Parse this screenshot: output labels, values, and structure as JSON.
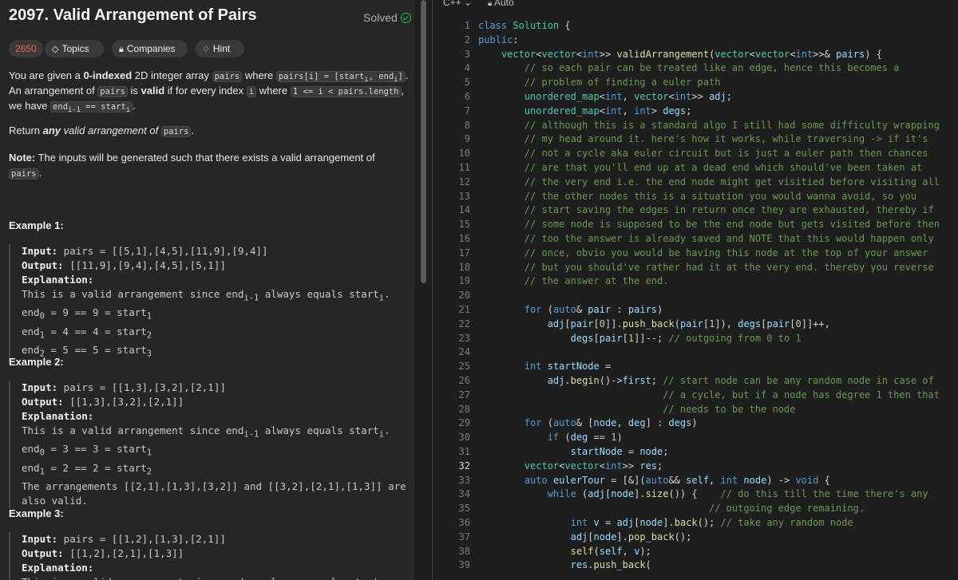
{
  "problem": {
    "title": "2097. Valid Arrangement of Pairs",
    "solved_label": "Solved",
    "tags": [
      "2650",
      "Topics",
      "Companies",
      "Hint"
    ],
    "statement_html": [
      "You are given a <b>0-indexed</b> 2D integer array <span class='code-inl'>pairs</span> where <span class='code-inl'>pairs[i] = [start<sub>i</sub>, end<sub>i</sub>]</span>.",
      "An arrangement of <span class='code-inl'>pairs</span> is <b>valid</b> if for every index <span class='code-inl'>i</span> where <span class='code-inl'>1 &lt;= i &lt; pairs.length</span>,",
      "we have <span class='code-inl'>end<sub>i-1</sub> == start<sub>i</sub></span>.",
      "",
      "Return <b><i>any</i></b> <i>valid arrangement of</i> <span class='code-inl'>pairs</span>.",
      "",
      "<b>Note:</b> The inputs will be generated such that there exists a valid arrangement of",
      "<span class='code-inl'>pairs</span>."
    ],
    "examples": [
      {
        "heading": "Example 1:",
        "lines_html": [
          "<b>Input:</b> pairs = [[5,1],[4,5],[11,9],[9,4]]",
          "<b>Output:</b> [[11,9],[9,4],[4,5],[5,1]]",
          "<b>Explanation:</b>",
          "This is a valid arrangement since end<sub>i-1</sub> always equals start<sub>i</sub>.",
          "end<sub>0</sub> = 9 == 9 = start<sub>1</sub>",
          "end<sub>1</sub> = 4 == 4 = start<sub>2</sub>",
          "end<sub>2</sub> = 5 == 5 = start<sub>3</sub>"
        ]
      },
      {
        "heading": "Example 2:",
        "lines_html": [
          "<b>Input:</b> pairs = [[1,3],[3,2],[2,1]]",
          "<b>Output:</b> [[1,3],[3,2],[2,1]]",
          "<b>Explanation:</b>",
          "This is a valid arrangement since end<sub>i-1</sub> always equals start<sub>i</sub>.",
          "end<sub>0</sub> = 3 == 3 = start<sub>1</sub>",
          "end<sub>1</sub> = 2 == 2 = start<sub>2</sub>",
          "The arrangements [[2,1],[1,3],[3,2]] and [[3,2],[2,1],[1,3]] are",
          "also valid."
        ]
      },
      {
        "heading": "Example 3:",
        "lines_html": [
          "<b>Input:</b> pairs = [[1,2],[1,3],[2,1]]",
          "<b>Output:</b> [[1,2],[2,1],[1,3]]",
          "<b>Explanation:</b>",
          "This is a valid arrangement since end<sub>i-1</sub> always equals start<sub>i</sub>."
        ]
      }
    ]
  },
  "editor": {
    "language": "C++",
    "mode": "Auto",
    "current_line": 32,
    "lines_html": [
      "<span class='kw'>class</span> <span class='ty'>Solution</span> {",
      "<span class='kw'>public</span>:",
      "    <span class='ty'>vector</span>&lt;<span class='ty'>vector</span>&lt;<span class='kw'>int</span>&gt;&gt; <span class='fn'>validArrangement</span>(<span class='ty'>vector</span>&lt;<span class='ty'>vector</span>&lt;<span class='kw'>int</span>&gt;&gt;&amp; <span class='vr'>pairs</span>) {",
      "        <span class='cm'>// so each pair can be treated like an edge, hence this becomes a</span>",
      "        <span class='cm'>// problem of finding a euler path</span>",
      "        <span class='ty'>unordered_map</span>&lt;<span class='kw'>int</span>, <span class='ty'>vector</span>&lt;<span class='kw'>int</span>&gt;&gt; <span class='vr'>adj</span>;",
      "        <span class='ty'>unordered_map</span>&lt;<span class='kw'>int</span>, <span class='kw'>int</span>&gt; <span class='vr'>degs</span>;",
      "        <span class='cm'>// although this is a standard algo I still had some difficulty wrapping</span>",
      "        <span class='cm'>// my head around it. here's how it works, while traversing -&gt; if it's</span>",
      "        <span class='cm'>// not a cycle aka euler circuit but is just a euler path then chances</span>",
      "        <span class='cm'>// are that you'll end up at a dead end which should've been taken at</span>",
      "        <span class='cm'>// the very end i.e. the end node might get visitied before visiting all</span>",
      "        <span class='cm'>// the other nodes this is a situation you would wanna avoid, so you</span>",
      "        <span class='cm'>// start saving the edges in return once they are exhausted, thereby if</span>",
      "        <span class='cm'>// some node is supposed to be the end node but gets visited before then</span>",
      "        <span class='cm'>// too the answer is already saved and NOTE that this would happen only</span>",
      "        <span class='cm'>// once, obvio you would be having this node at the top of your answer</span>",
      "        <span class='cm'>// but you should've rather had it at the very end. thereby you reverse</span>",
      "        <span class='cm'>// the answer at the end.</span>",
      "",
      "        <span class='kw'>for</span> (<span class='kw'>auto</span>&amp; <span class='vr'>pair</span> : <span class='vr'>pairs</span>)",
      "            <span class='vr'>adj</span>[<span class='vr'>pair</span>[<span class='nm'>0</span>]].<span class='fn'>push_back</span>(<span class='vr'>pair</span>[<span class='nm'>1</span>]), <span class='vr'>degs</span>[<span class='vr'>pair</span>[<span class='nm'>0</span>]]++,",
      "                <span class='vr'>degs</span>[<span class='vr'>pair</span>[<span class='nm'>1</span>]]--; <span class='cm'>// outgoing from 0 to 1</span>",
      "",
      "        <span class='kw'>int</span> <span class='vr'>startNode</span> =",
      "            <span class='vr'>adj</span>.<span class='fn'>begin</span>()-&gt;<span class='vr'>first</span>; <span class='cm'>// start node can be any random node in case of</span>",
      "                                <span class='cm'>// a cycle, but if a node has degree 1 then that</span>",
      "                                <span class='cm'>// needs to be the node</span>",
      "        <span class='kw'>for</span> (<span class='kw'>auto</span>&amp; [<span class='vr'>node</span>, <span class='vr'>deg</span>] : <span class='vr'>degs</span>)",
      "            <span class='kw'>if</span> (<span class='vr'>deg</span> == <span class='nm'>1</span>)",
      "                <span class='vr'>startNode</span> = <span class='vr'>node</span>;",
      "        <span class='ty'>vector</span>&lt;<span class='ty'>vector</span>&lt;<span class='kw'>int</span>&gt;&gt; <span class='vr'>res</span>;",
      "        <span class='kw'>auto</span> <span class='vr'>eulerTour</span> = [&amp;](<span class='kw'>auto</span>&amp;&amp; <span class='vr'>self</span>, <span class='kw'>int</span> <span class='vr'>node</span>) -&gt; <span class='kw'>void</span> {",
      "            <span class='kw'>while</span> (<span class='vr'>adj</span>[<span class='vr'>node</span>].<span class='fn'>size</span>()) {    <span class='cm'>// do this till the time there's any</span>",
      "                                        <span class='cm'>// outgoing edge remaining.</span>",
      "                <span class='kw'>int</span> <span class='vr'>v</span> = <span class='vr'>adj</span>[<span class='vr'>node</span>].<span class='fn'>back</span>(); <span class='cm'>// take any random node</span>",
      "                <span class='vr'>adj</span>[<span class='vr'>node</span>].<span class='fn'>pop_back</span>();",
      "                <span class='fn'>self</span>(<span class='vr'>self</span>, <span class='vr'>v</span>);",
      "                <span class='vr'>res</span>.<span class='fn'>push_back</span>("
    ]
  }
}
